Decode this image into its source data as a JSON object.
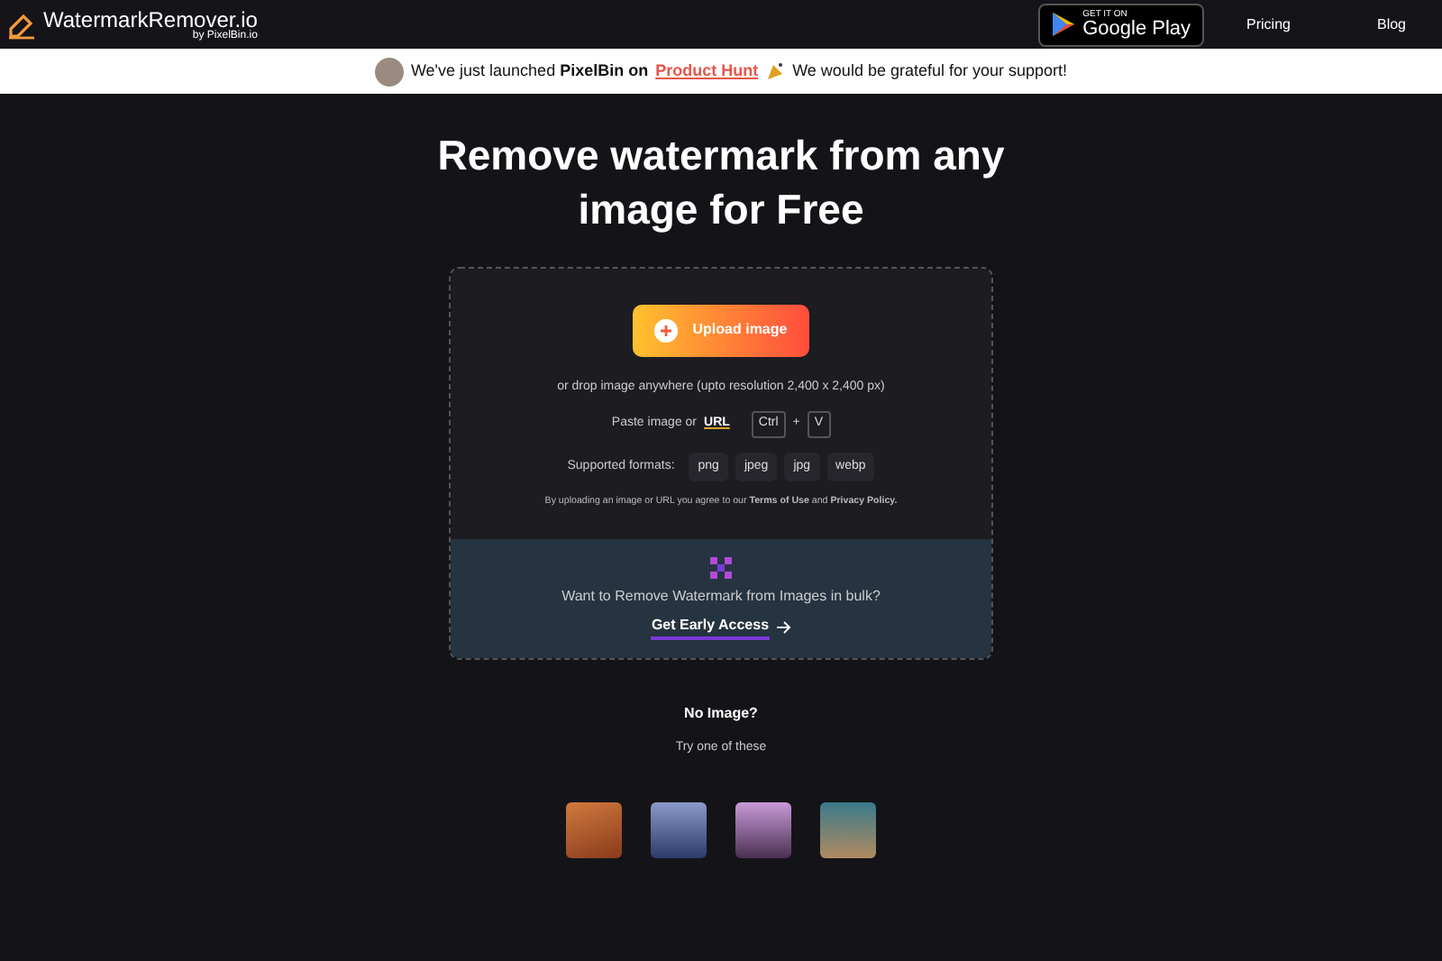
{
  "header": {
    "logo_text": "WatermarkRemover.io",
    "logo_sub": "by PixelBin.io",
    "store_badge": {
      "small": "GET IT ON",
      "large": "Google Play"
    },
    "nav": [
      "Pricing",
      "Blog"
    ]
  },
  "banner": {
    "lead": "We've just launched **PixelBin on**",
    "link": "Product Hunt",
    "tail": "We would be grateful for your support!"
  },
  "hero": {
    "title": "Remove watermark from any image for Free"
  },
  "upload": {
    "button": "Upload image",
    "drop_hint": "or drop image anywhere (upto resolution 2,400 x 2,400 px)",
    "paste_label": "Paste image or",
    "paste_link": "URL",
    "keys": [
      "Ctrl",
      "+",
      "V"
    ],
    "formats_label": "Supported formats:",
    "formats": [
      "png",
      "jpeg",
      "jpg",
      "webp"
    ],
    "terms": "By uploading an image or URL you agree to our **Terms of Use** and **Privacy Policy.**"
  },
  "bulk": {
    "text": "Want to Remove Watermark from Images in bulk?",
    "link": "Get Early Access"
  },
  "samples": {
    "title": "No Image?",
    "subtitle": "Try one of these"
  }
}
